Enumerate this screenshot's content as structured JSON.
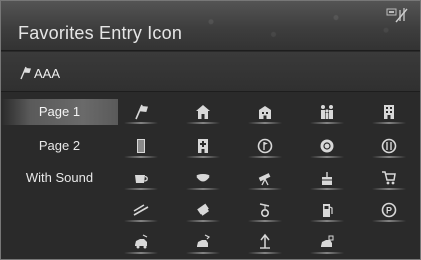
{
  "header": {
    "title": "Favorites Entry Icon",
    "status_icon": "signal-off-icon"
  },
  "entry": {
    "icon": "flag-icon",
    "name": "AAA"
  },
  "sidebar": {
    "items": [
      {
        "label": "Page 1",
        "selected": true
      },
      {
        "label": "Page 2",
        "selected": false
      },
      {
        "label": "With Sound",
        "selected": false
      }
    ]
  },
  "grid": {
    "rows": [
      [
        "flag-icon",
        "house-icon",
        "office-icon",
        "family-icon",
        "building-icon"
      ],
      [
        "tall-building-icon",
        "hospital-icon",
        "golf-icon",
        "sports-icon",
        "restaurant-icon"
      ],
      [
        "coffee-icon",
        "bowl-icon",
        "telescope-icon",
        "cake-icon",
        "shopping-cart-icon"
      ],
      [
        "ski-icon",
        "tickets-icon",
        "fishing-icon",
        "gas-pump-icon",
        "parking-icon"
      ],
      [
        "car-icon",
        "car-swap-icon",
        "arrow-car-icon",
        "truck-icon"
      ]
    ]
  },
  "colors": {
    "background": "#2a2a2a",
    "text": "#e8e8e8",
    "icon": "#d8d8d8"
  }
}
